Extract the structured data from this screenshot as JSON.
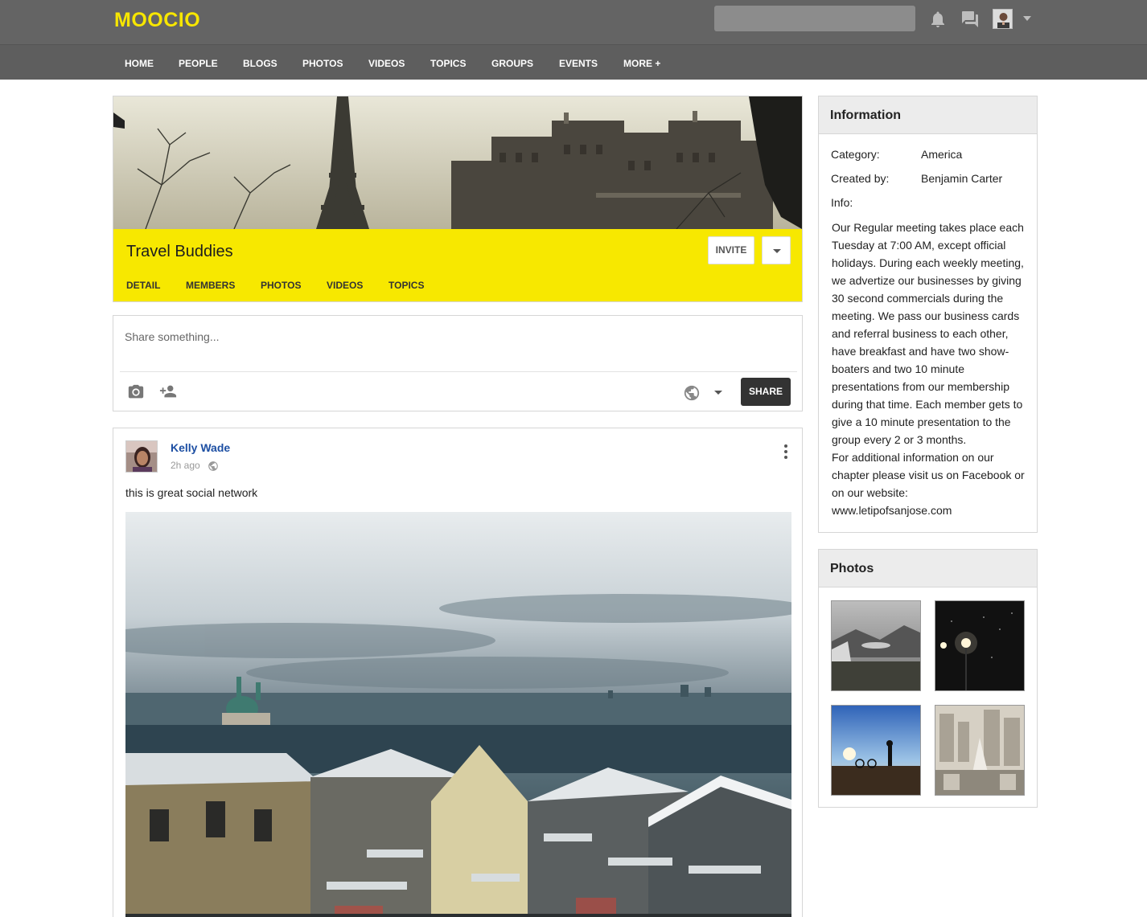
{
  "header": {
    "logo": "MOOCIO",
    "search_placeholder": "",
    "icons": [
      "bell-icon",
      "chat-icon",
      "user-avatar",
      "chevron-down-icon"
    ],
    "accent_color": "#f7e600"
  },
  "nav": {
    "items": [
      {
        "label": "HOME"
      },
      {
        "label": "PEOPLE"
      },
      {
        "label": "BLOGS"
      },
      {
        "label": "PHOTOS"
      },
      {
        "label": "VIDEOS"
      },
      {
        "label": "TOPICS"
      },
      {
        "label": "GROUPS"
      },
      {
        "label": "EVENTS"
      },
      {
        "label": "MORE +"
      }
    ]
  },
  "group": {
    "title": "Travel Buddies",
    "invite_label": "INVITE",
    "bar_color": "#f7e800",
    "tabs": [
      {
        "label": "DETAIL"
      },
      {
        "label": "MEMBERS"
      },
      {
        "label": "PHOTOS"
      },
      {
        "label": "VIDEOS"
      },
      {
        "label": "TOPICS"
      }
    ]
  },
  "share": {
    "placeholder": "Share something...",
    "button_label": "SHARE",
    "icons": [
      "camera-icon",
      "add-person-icon",
      "globe-icon",
      "chevron-down-icon"
    ]
  },
  "post": {
    "author": "Kelly Wade",
    "time": "2h ago",
    "text": "this is great social network",
    "icons": [
      "globe-icon",
      "more-vertical-icon"
    ]
  },
  "information": {
    "title": "Information",
    "category_label": "Category:",
    "category_value": "America",
    "created_label": "Created by:",
    "created_value": "Benjamin Carter",
    "info_label": "Info:",
    "info_text": "Our Regular meeting takes place each Tuesday at 7:00 AM, except official holidays. During each weekly meeting, we advertize our businesses by giving 30 second commercials during the meeting. We pass our business cards and referral business to each other, have breakfast and have two show-boaters and two 10 minute presentations from our membership during that time. Each member gets to give a 10 minute presentation to the group every 2 or 3 months.\nFor additional information on our chapter please visit us on Facebook or on our website:\nwww.letipofsanjose.com"
  },
  "photos": {
    "title": "Photos",
    "items": [
      "mountain-valley-photo",
      "night-lamps-photo",
      "beach-silhouette-photo",
      "city-aerial-photo"
    ]
  }
}
